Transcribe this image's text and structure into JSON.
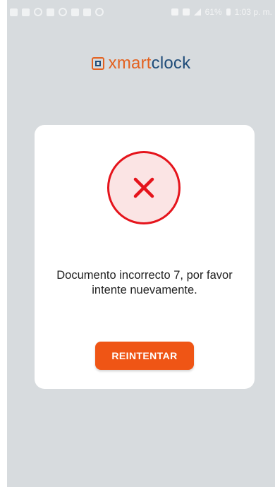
{
  "status_bar": {
    "left_icons": [
      "facebook-icon",
      "location-icon",
      "instagram-icon",
      "w-icon",
      "location-outline-icon",
      "image-icon",
      "send-icon",
      "settings-icon"
    ],
    "right_icons": [
      "sim-icon",
      "sim-icon",
      "signal-icon"
    ],
    "battery": "61%",
    "time": "1:03 p. m."
  },
  "logo": {
    "part1": "xmart",
    "part2": "clock"
  },
  "dialog": {
    "message": "Documento incorrecto 7, por favor intente nuevamente.",
    "retry_label": "REINTENTAR",
    "icon": "error-x-icon"
  },
  "colors": {
    "background": "#d7dbde",
    "accent": "#ef5515",
    "error": "#e5141c",
    "brand_blue": "#1f4c79"
  }
}
